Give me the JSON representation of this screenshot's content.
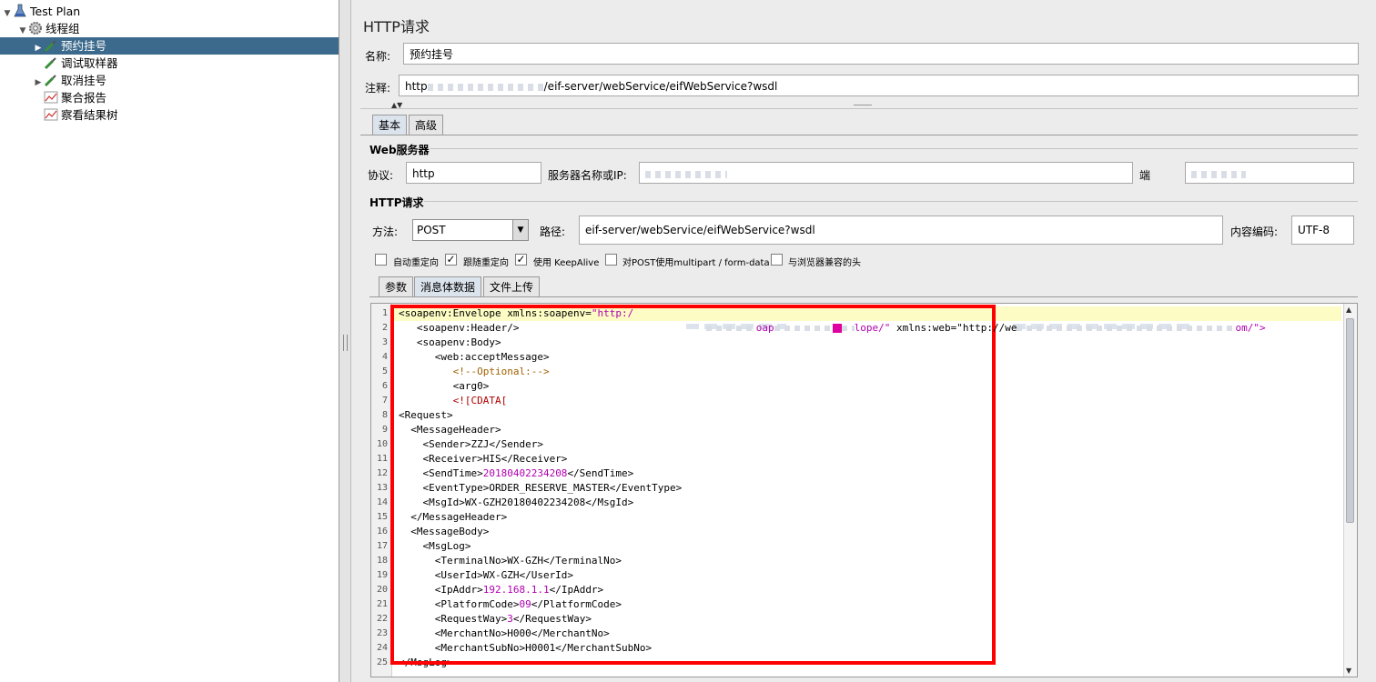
{
  "tree": {
    "items": [
      {
        "label": "Test Plan",
        "icon": "flask-icon",
        "twisty": "▼",
        "indent": 0
      },
      {
        "label": "线程组",
        "icon": "gear-icon",
        "twisty": "▼",
        "indent": 1
      },
      {
        "label": "预约挂号",
        "icon": "pipette-icon",
        "twisty": "▶",
        "indent": 2,
        "selected": true
      },
      {
        "label": "调试取样器",
        "icon": "pipette-icon",
        "twisty": "",
        "indent": 2
      },
      {
        "label": "取消挂号",
        "icon": "pipette-icon",
        "twisty": "▶",
        "indent": 2
      },
      {
        "label": "聚合报告",
        "icon": "chart-icon",
        "twisty": "",
        "indent": 2
      },
      {
        "label": "察看结果树",
        "icon": "chart-icon",
        "twisty": "",
        "indent": 2
      }
    ]
  },
  "panel": {
    "title": "HTTP请求",
    "name_label": "名称:",
    "name_value": "预约挂号",
    "comment_label": "注释:",
    "comment_prefix": "http",
    "comment_suffix": "/eif-server/webService/eifWebService?wsdl"
  },
  "tabs": {
    "basic": "基本",
    "advanced": "高级"
  },
  "web_server": {
    "section_title": "Web服务器",
    "protocol_label": "协议:",
    "protocol_value": "http",
    "server_label": "服务器名称或IP:",
    "port_label": "端"
  },
  "http_request": {
    "section_title": "HTTP请求",
    "method_label": "方法:",
    "method_value": "POST",
    "path_label": "路径:",
    "path_value": "eif-server/webService/eifWebService?wsdl",
    "encoding_label": "内容编码:",
    "encoding_value": "UTF-8"
  },
  "options": [
    {
      "label": "自动重定向",
      "checked": false
    },
    {
      "label": "跟随重定向",
      "checked": true
    },
    {
      "label": "使用 KeepAlive",
      "checked": true
    },
    {
      "label": "对POST使用multipart / form-data",
      "checked": false
    },
    {
      "label": "与浏览器兼容的头",
      "checked": false
    }
  ],
  "body_tabs": {
    "params": "参数",
    "body": "消息体数据",
    "files": "文件上传"
  },
  "code_lines": [
    "<soapenv:Envelope xmlns:soapenv=\"http:/",
    "   <soapenv:Header/>",
    "   <soapenv:Body>",
    "      <web:acceptMessage>",
    "         <!--Optional:-->",
    "         <arg0>",
    "         <![CDATA[",
    "<Request>",
    "  <MessageHeader>",
    "    <Sender>ZZJ</Sender>",
    "    <Receiver>HIS</Receiver>",
    "    <SendTime>20180402234208</SendTime>",
    "    <EventType>ORDER_RESERVE_MASTER</EventType>",
    "    <MsgId>WX-GZH20180402234208</MsgId>",
    "  </MessageHeader>",
    "  <MessageBody>",
    "    <MsgLog>",
    "      <TerminalNo>WX-GZH</TerminalNo>",
    "      <UserId>WX-GZH</UserId>",
    "      <IpAddr>192.168.1.1</IpAddr>",
    "      <PlatformCode>09</PlatformCode>",
    "      <RequestWay>3</RequestWay>",
    "      <MerchantNo>H000</MerchantNo>",
    "      <MerchantSubNo>H0001</MerchantSubNo>",
    "</MsgLog>"
  ],
  "line1_fragments": {
    "frag1": "oap",
    "frag2": "lope/\"",
    "frag3": " xmlns:web=\"http://we",
    "frag4": "om/\">"
  },
  "colors": {
    "selection": "#3c6a8c",
    "annotation_box": "#ff0000",
    "current_line": "#fcfcc4"
  }
}
